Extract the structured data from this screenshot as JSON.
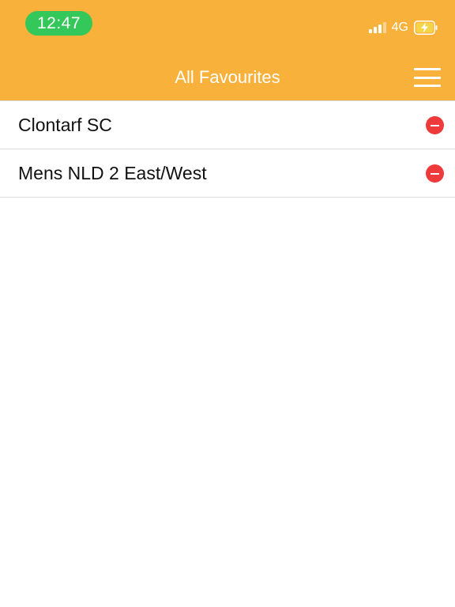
{
  "status_bar": {
    "time": "12:47",
    "network": "4G",
    "signal_bars_active": 3,
    "signal_bars_total": 4,
    "battery_icon": "battery-charging-icon",
    "pill_color": "#34C759"
  },
  "nav": {
    "title": "All Favourites",
    "menu_icon": "hamburger-menu-icon",
    "bar_color": "#F8B13A"
  },
  "favourites": [
    {
      "label": "Clontarf SC",
      "action_icon": "remove-icon"
    },
    {
      "label": "Mens NLD 2 East/West",
      "action_icon": "remove-icon"
    }
  ],
  "colors": {
    "remove": "#EE3A3A",
    "battery_fill": "#F5D547"
  }
}
